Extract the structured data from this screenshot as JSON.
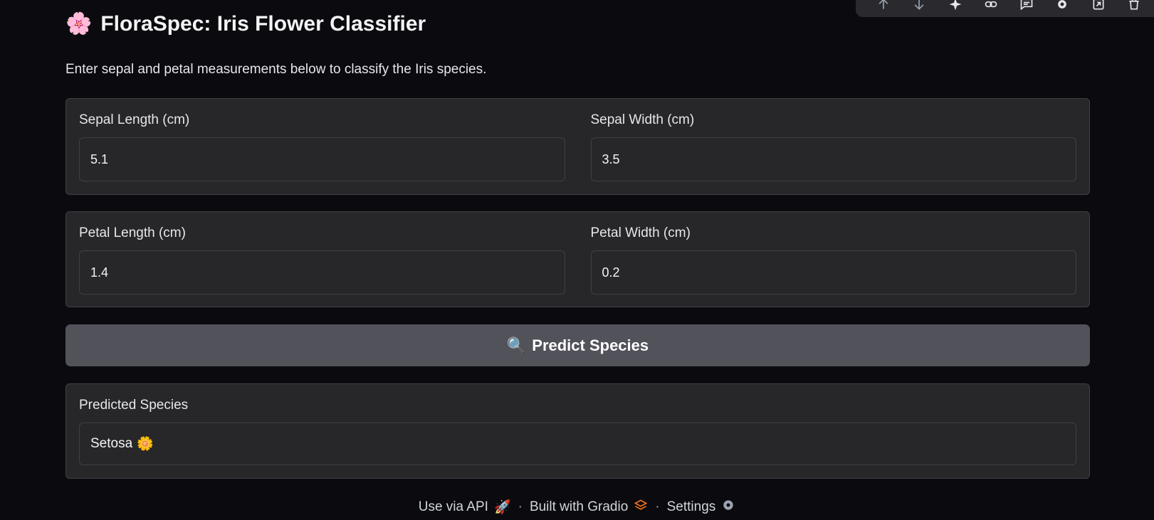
{
  "toolbar": {
    "icons": [
      "arrow-up-icon",
      "arrow-down-icon",
      "sparkle-icon",
      "link-icon",
      "comment-icon",
      "gear-icon",
      "export-icon",
      "trash-icon"
    ]
  },
  "header": {
    "emoji": "🌸",
    "title": "FloraSpec: Iris Flower Classifier",
    "subtitle": "Enter sepal and petal measurements below to classify the Iris species."
  },
  "sepal": {
    "length_label": "Sepal Length (cm)",
    "length_value": "5.1",
    "width_label": "Sepal Width (cm)",
    "width_value": "3.5"
  },
  "petal": {
    "length_label": "Petal Length (cm)",
    "length_value": "1.4",
    "width_label": "Petal Width (cm)",
    "width_value": "0.2"
  },
  "predict": {
    "icon": "🔍",
    "label": "Predict Species"
  },
  "output": {
    "label": "Predicted Species",
    "value": "Setosa",
    "emoji": "🌼"
  },
  "footer": {
    "api_label": "Use via API",
    "api_icon": "🚀",
    "built_label": "Built with Gradio",
    "built_icon": "gradio-logo-icon",
    "settings_label": "Settings",
    "settings_icon": "gear-icon",
    "separator": "·"
  },
  "colors": {
    "background": "#0b0b0f",
    "panel": "#27272a",
    "button": "#52525b",
    "gradio_orange": "#f97316"
  }
}
